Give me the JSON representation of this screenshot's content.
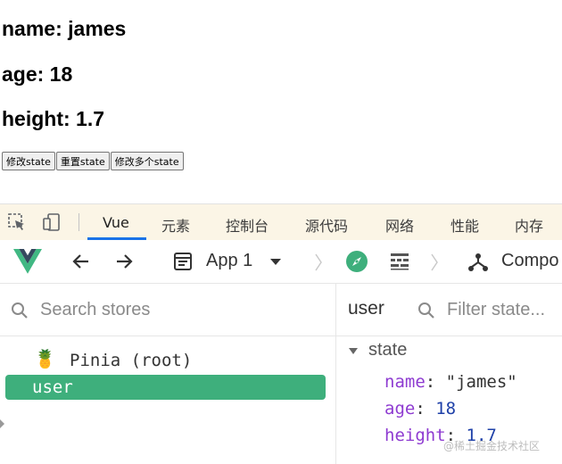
{
  "page": {
    "name_line": "name: james",
    "age_line": "age: 18",
    "height_line": "height: 1.7",
    "buttons": [
      "修改state",
      "重置state",
      "修改多个state"
    ]
  },
  "devtools_tabs": [
    "Vue",
    "元素",
    "控制台",
    "源代码",
    "网络",
    "性能",
    "内存"
  ],
  "vue_toolbar": {
    "app_label": "App 1",
    "components_label": "Compo"
  },
  "stores": {
    "search_placeholder": "Search stores",
    "root_label": "Pinia (root)",
    "root_icon": "🍍",
    "selected_store": "user"
  },
  "inspector": {
    "title": "user",
    "filter_placeholder": "Filter state...",
    "section": "state",
    "props": [
      {
        "key": "name",
        "value": "\"james\""
      },
      {
        "key": "age",
        "value": "18"
      },
      {
        "key": "height",
        "value": "1.7"
      }
    ]
  },
  "watermark": "@稀土掘金技术社区",
  "colors": {
    "vue_green": "#3eaf7c",
    "tab_accent": "#1a73e8",
    "prop_key": "#8e3bd1"
  }
}
